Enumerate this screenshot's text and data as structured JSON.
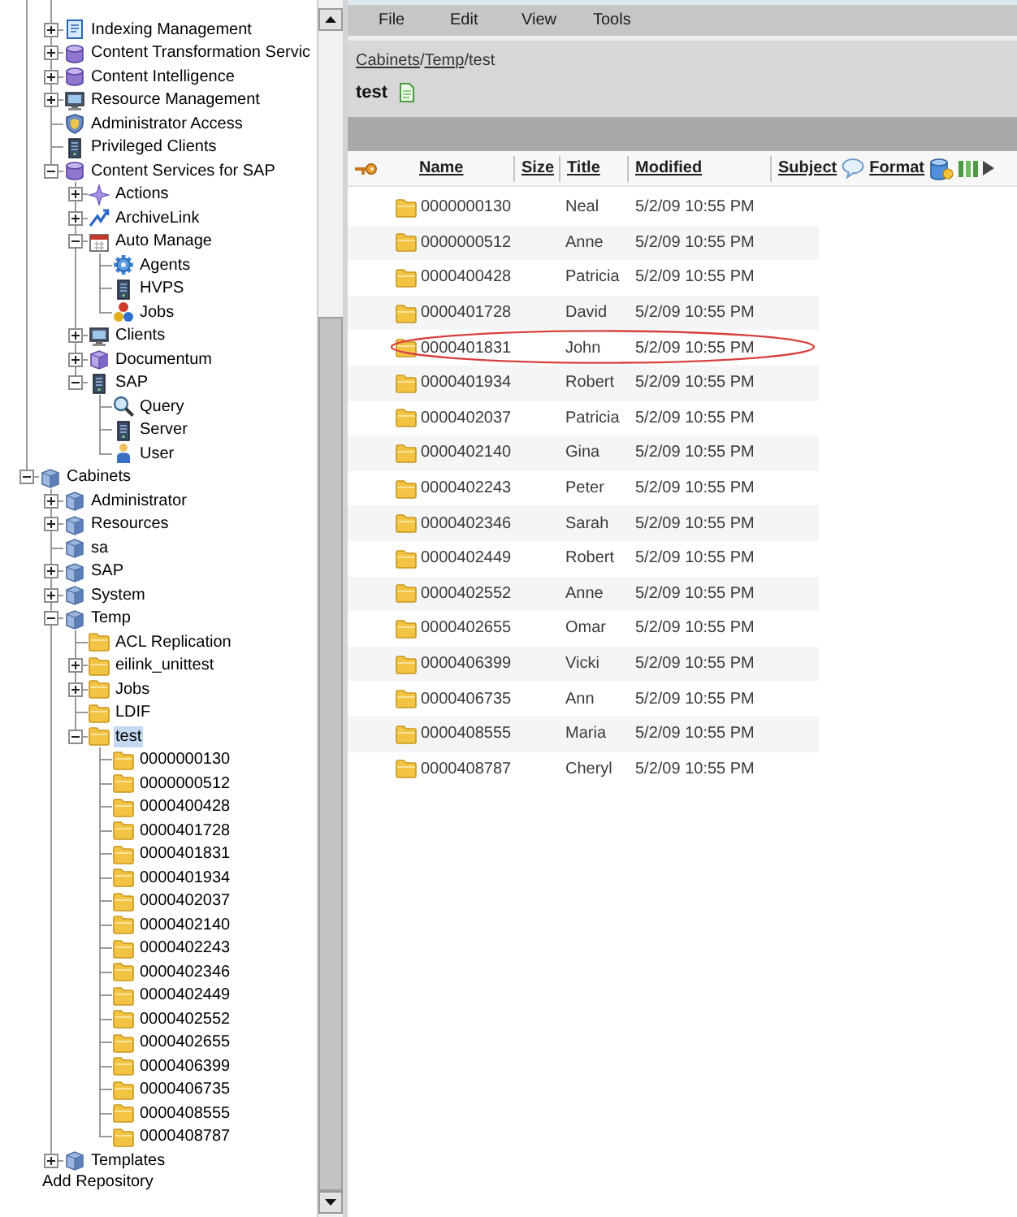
{
  "tree": {
    "scrolled_branch": [
      {
        "label": "Indexing Management",
        "kind": "document",
        "expanded": false,
        "selected": false
      },
      {
        "label": "Content Transformation Servic",
        "kind": "database",
        "expanded": false,
        "selected": false
      },
      {
        "label": "Content Intelligence",
        "kind": "database",
        "expanded": false,
        "selected": false
      },
      {
        "label": "Resource Management",
        "kind": "monitor",
        "expanded": false,
        "selected": false
      },
      {
        "label": "Administrator Access",
        "kind": "shield",
        "selected": false
      },
      {
        "label": "Privileged Clients",
        "kind": "server",
        "selected": false
      },
      {
        "label": "Content Services for SAP",
        "kind": "database",
        "expanded": true,
        "selected": false,
        "children": [
          {
            "label": "Actions",
            "kind": "star",
            "expanded": false,
            "selected": false
          },
          {
            "label": "ArchiveLink",
            "kind": "arrow",
            "expanded": false,
            "selected": false
          },
          {
            "label": "Auto Manage",
            "kind": "calendar",
            "expanded": true,
            "selected": false,
            "children": [
              {
                "label": "Agents",
                "kind": "gear",
                "selected": false
              },
              {
                "label": "HVPS",
                "kind": "server",
                "selected": false
              },
              {
                "label": "Jobs",
                "kind": "balls",
                "selected": false
              }
            ]
          },
          {
            "label": "Clients",
            "kind": "monitor",
            "expanded": false,
            "selected": false
          },
          {
            "label": "Documentum",
            "kind": "cube",
            "expanded": false,
            "selected": false
          },
          {
            "label": "SAP",
            "kind": "server",
            "expanded": true,
            "selected": false,
            "children": [
              {
                "label": "Query",
                "kind": "query",
                "selected": false
              },
              {
                "label": "Server",
                "kind": "server",
                "selected": false
              },
              {
                "label": "User",
                "kind": "person",
                "selected": false
              }
            ]
          }
        ]
      }
    ],
    "items": [
      {
        "label": "Cabinets",
        "kind": "cabinet",
        "expanded": true,
        "selected": false,
        "children": [
          {
            "label": "Administrator",
            "kind": "cabinet",
            "expanded": false,
            "selected": false
          },
          {
            "label": "Resources",
            "kind": "cabinet",
            "expanded": false,
            "selected": false
          },
          {
            "label": "sa",
            "kind": "cabinet",
            "selected": false
          },
          {
            "label": "SAP",
            "kind": "cabinet",
            "expanded": false,
            "selected": false
          },
          {
            "label": "System",
            "kind": "cabinet",
            "expanded": false,
            "selected": false
          },
          {
            "label": "Temp",
            "kind": "cabinet",
            "expanded": true,
            "selected": false,
            "children": [
              {
                "label": "ACL Replication",
                "kind": "folder",
                "selected": false
              },
              {
                "label": "eilink_unittest",
                "kind": "folder",
                "expanded": false,
                "selected": false
              },
              {
                "label": "Jobs",
                "kind": "folder",
                "expanded": false,
                "selected": false
              },
              {
                "label": "LDIF",
                "kind": "folder",
                "selected": false
              },
              {
                "label": "test",
                "kind": "folder",
                "expanded": true,
                "selected": true,
                "children": [
                  {
                    "label": "0000000130",
                    "kind": "folder",
                    "selected": false
                  },
                  {
                    "label": "0000000512",
                    "kind": "folder",
                    "selected": false
                  },
                  {
                    "label": "0000400428",
                    "kind": "folder",
                    "selected": false
                  },
                  {
                    "label": "0000401728",
                    "kind": "folder",
                    "selected": false
                  },
                  {
                    "label": "0000401831",
                    "kind": "folder",
                    "selected": false
                  },
                  {
                    "label": "0000401934",
                    "kind": "folder",
                    "selected": false
                  },
                  {
                    "label": "0000402037",
                    "kind": "folder",
                    "selected": false
                  },
                  {
                    "label": "0000402140",
                    "kind": "folder",
                    "selected": false
                  },
                  {
                    "label": "0000402243",
                    "kind": "folder",
                    "selected": false
                  },
                  {
                    "label": "0000402346",
                    "kind": "folder",
                    "selected": false
                  },
                  {
                    "label": "0000402449",
                    "kind": "folder",
                    "selected": false
                  },
                  {
                    "label": "0000402552",
                    "kind": "folder",
                    "selected": false
                  },
                  {
                    "label": "0000402655",
                    "kind": "folder",
                    "selected": false
                  },
                  {
                    "label": "0000406399",
                    "kind": "folder",
                    "selected": false
                  },
                  {
                    "label": "0000406735",
                    "kind": "folder",
                    "selected": false
                  },
                  {
                    "label": "0000408555",
                    "kind": "folder",
                    "selected": false
                  },
                  {
                    "label": "0000408787",
                    "kind": "folder",
                    "selected": false
                  }
                ]
              }
            ]
          },
          {
            "label": "Templates",
            "kind": "cabinet",
            "expanded": false,
            "selected": false
          }
        ]
      }
    ]
  },
  "add_repository": "Add Repository",
  "menu": [
    "File",
    "Edit",
    "View",
    "Tools"
  ],
  "location": {
    "breadcrumb": [
      {
        "label": "Cabinets",
        "link": true,
        "separator": "/"
      },
      {
        "label": "Temp",
        "link": true,
        "separator": "/"
      },
      {
        "label": "test",
        "link": false
      }
    ],
    "title": "test"
  },
  "table": {
    "columns": [
      {
        "label": "Name"
      },
      {
        "label": "Size"
      },
      {
        "label": "Title"
      },
      {
        "label": "Modified"
      },
      {
        "label": "Subject"
      },
      {
        "label": "Format"
      }
    ],
    "rows": [
      {
        "name": "0000000130",
        "title": "Neal",
        "modified": "5/2/09 10:55 PM",
        "selected": false,
        "circled": false
      },
      {
        "name": "0000000512",
        "title": "Anne",
        "modified": "5/2/09 10:55 PM",
        "selected": false,
        "circled": false
      },
      {
        "name": "0000400428",
        "title": "Patricia",
        "modified": "5/2/09 10:55 PM",
        "selected": false,
        "circled": false
      },
      {
        "name": "0000401728",
        "title": "David",
        "modified": "5/2/09 10:55 PM",
        "selected": false,
        "circled": false
      },
      {
        "name": "0000401831",
        "title": "John",
        "modified": "5/2/09 10:55 PM",
        "selected": false,
        "circled": true
      },
      {
        "name": "0000401934",
        "title": "Robert",
        "modified": "5/2/09 10:55 PM",
        "selected": false,
        "circled": false
      },
      {
        "name": "0000402037",
        "title": "Patricia",
        "modified": "5/2/09 10:55 PM",
        "selected": false,
        "circled": false
      },
      {
        "name": "0000402140",
        "title": "Gina",
        "modified": "5/2/09 10:55 PM",
        "selected": false,
        "circled": false
      },
      {
        "name": "0000402243",
        "title": "Peter",
        "modified": "5/2/09 10:55 PM",
        "selected": false,
        "circled": false
      },
      {
        "name": "0000402346",
        "title": "Sarah",
        "modified": "5/2/09 10:55 PM",
        "selected": false,
        "circled": false
      },
      {
        "name": "0000402449",
        "title": "Robert",
        "modified": "5/2/09 10:55 PM",
        "selected": false,
        "circled": false
      },
      {
        "name": "0000402552",
        "title": "Anne",
        "modified": "5/2/09 10:55 PM",
        "selected": false,
        "circled": false
      },
      {
        "name": "0000402655",
        "title": "Omar",
        "modified": "5/2/09 10:55 PM",
        "selected": false,
        "circled": false
      },
      {
        "name": "0000406399",
        "title": "Vicki",
        "modified": "5/2/09 10:55 PM",
        "selected": false,
        "circled": false
      },
      {
        "name": "0000406735",
        "title": "Ann",
        "modified": "5/2/09 10:55 PM",
        "selected": false,
        "circled": false
      },
      {
        "name": "0000408555",
        "title": "Maria",
        "modified": "5/2/09 10:55 PM",
        "selected": false,
        "circled": false
      },
      {
        "name": "0000408787",
        "title": "Cheryl",
        "modified": "5/2/09 10:55 PM",
        "selected": false,
        "circled": false
      }
    ]
  }
}
